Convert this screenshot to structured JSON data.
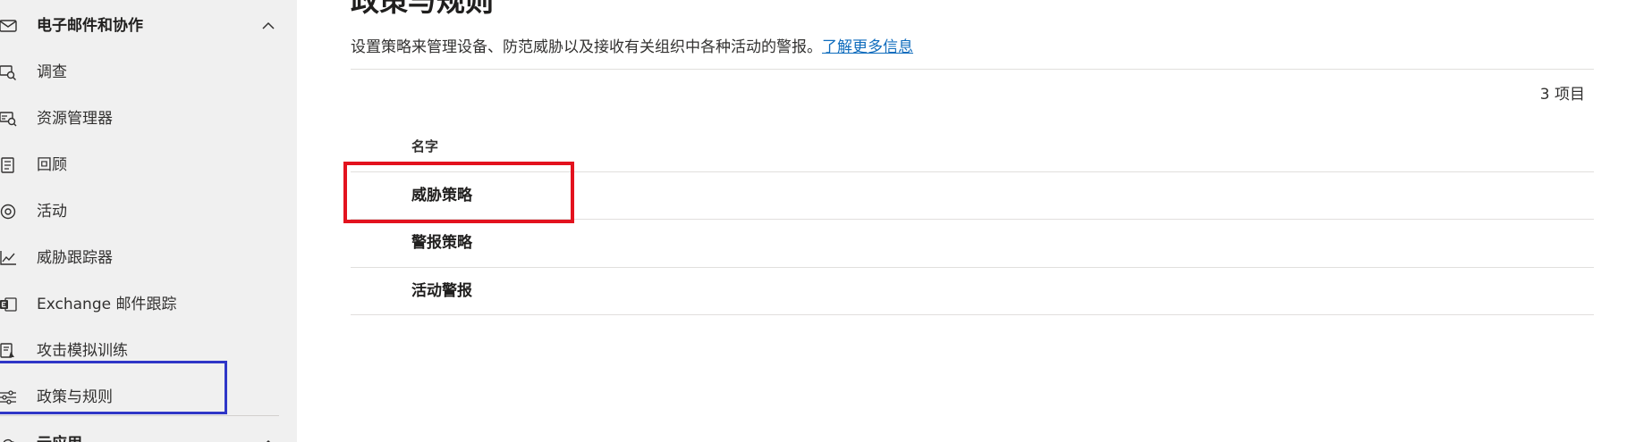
{
  "sidebar": {
    "group_email": "电子邮件和协作",
    "items": [
      {
        "label": "调查",
        "icon": "investigation-icon"
      },
      {
        "label": "资源管理器",
        "icon": "explorer-icon"
      },
      {
        "label": "回顾",
        "icon": "review-icon"
      },
      {
        "label": "活动",
        "icon": "campaigns-icon"
      },
      {
        "label": "威胁跟踪器",
        "icon": "threat-tracker-icon"
      },
      {
        "label": "Exchange 邮件跟踪",
        "icon": "exchange-icon"
      },
      {
        "label": "攻击模拟训练",
        "icon": "attack-simulation-icon"
      },
      {
        "label": "政策与规则",
        "icon": "policy-sliders-icon"
      }
    ],
    "group_cloud": "云应用"
  },
  "main": {
    "title": "政策与规则",
    "description": "设置策略来管理设备、防范威胁以及接收有关组织中各种活动的警报。",
    "learn_more": "了解更多信息",
    "item_count": "3 项目",
    "column_name": "名字",
    "rows": [
      "威胁策略",
      "警报策略",
      "活动警报"
    ]
  },
  "colors": {
    "selection_outline": "#2f36c7",
    "highlight_outline": "#e3121e",
    "link": "#0f6cbd",
    "sidebar_bg": "#f0f0f0"
  }
}
